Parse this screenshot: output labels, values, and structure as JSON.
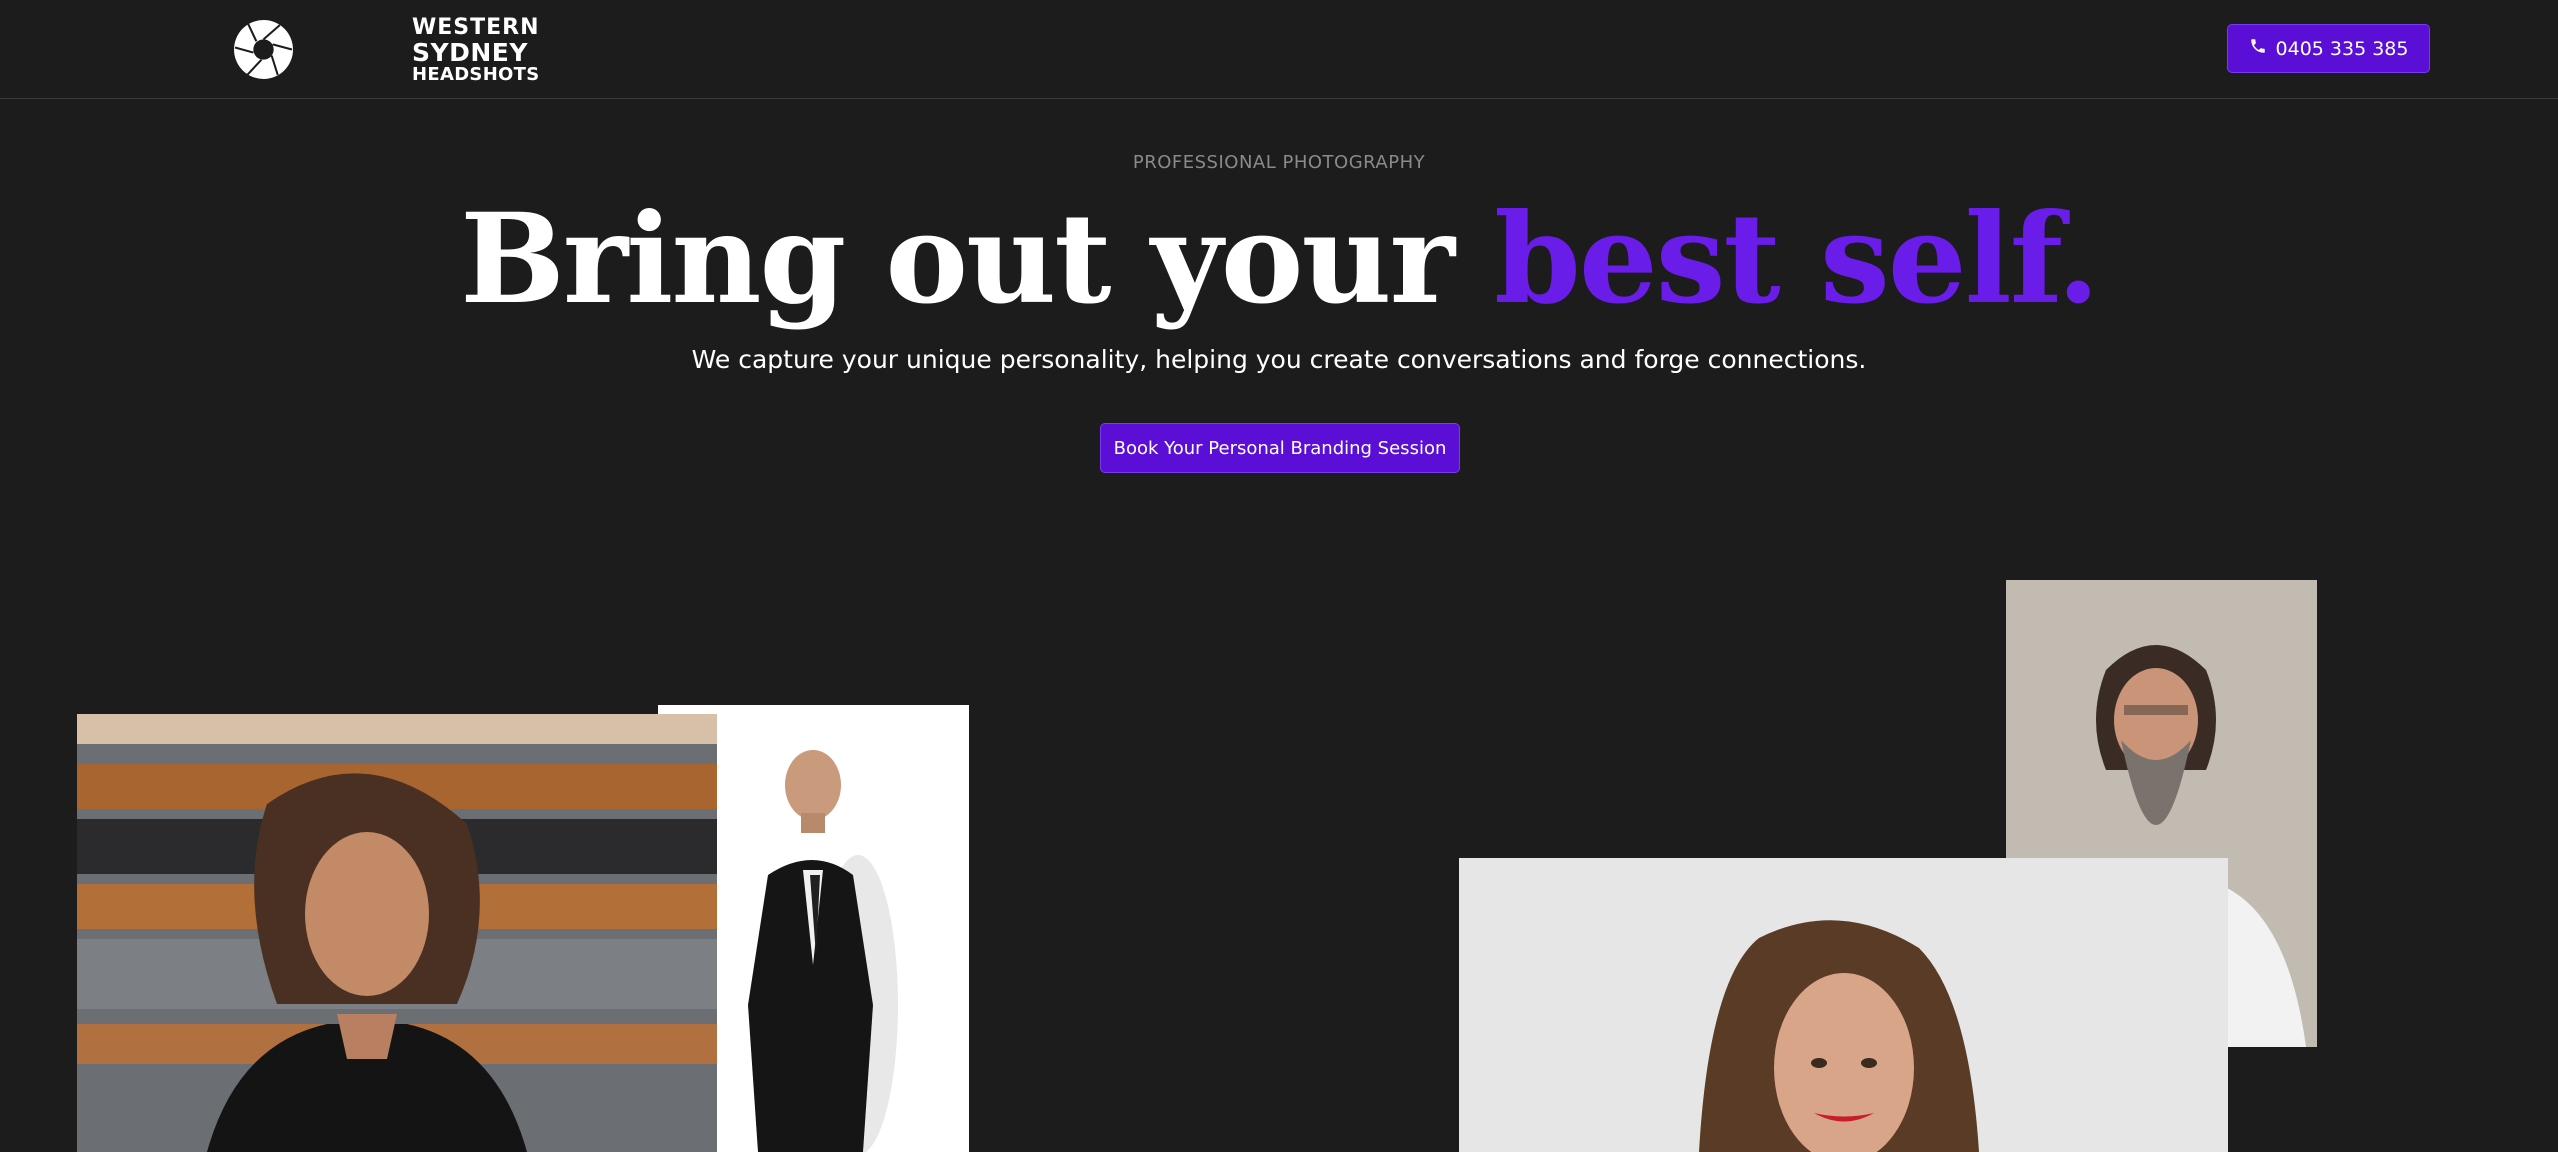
{
  "header": {
    "logo": {
      "line1": "WESTERN",
      "line2": "SYDNEY",
      "line3": "HEADSHOTS",
      "icon": "camera-aperture-icon"
    },
    "phone_button": {
      "label": "0405 335 385",
      "icon": "phone-icon"
    }
  },
  "hero": {
    "eyebrow": "PROFESSIONAL PHOTOGRAPHY",
    "headline_main": "Bring out your ",
    "headline_accent": "best self.",
    "subheadline": "We capture your unique personality, helping you create conversations and forge connections.",
    "cta_label": "Book Your Personal Branding Session"
  },
  "colors": {
    "background": "#1c1c1c",
    "accent": "#6a1ce8",
    "button": "#5b0fd6",
    "muted_text": "#8a8a8a"
  }
}
